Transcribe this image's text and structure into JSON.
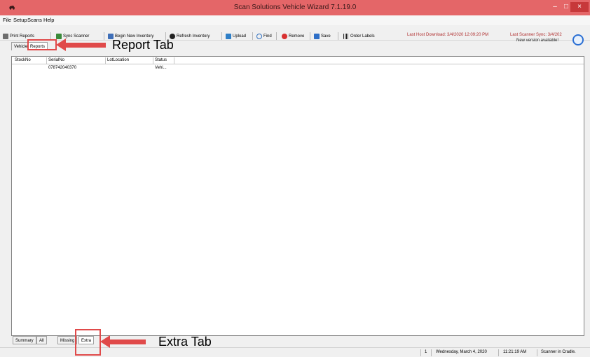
{
  "window": {
    "title": "Scan Solutions Vehicle Wizard 7.1.19.0",
    "minimize_glyph": "–",
    "maximize_glyph": "□",
    "close_glyph": "×"
  },
  "menu": [
    "File",
    "Setup",
    "Scans",
    "Help"
  ],
  "toolbar": {
    "buttons": [
      {
        "label": "Print Reports",
        "icon": "printer-icon"
      },
      {
        "label": "Sync Scanner",
        "icon": "sync-icon"
      },
      {
        "label": "Begin New Inventory",
        "icon": "new-inventory-icon"
      },
      {
        "label": "Refresh Inventory",
        "icon": "refresh-icon"
      },
      {
        "label": "Upload",
        "icon": "upload-icon"
      },
      {
        "label": "Find",
        "icon": "find-icon"
      },
      {
        "label": "Remove",
        "icon": "remove-icon"
      },
      {
        "label": "Save",
        "icon": "save-icon"
      },
      {
        "label": "Order Labels",
        "icon": "barcode-icon"
      }
    ],
    "host_status": "Last Host Download: 3/4/2020 12:09:20 PM",
    "scanner_status": "Last Scanner Sync: 3/4/202",
    "new_version": "New version available!"
  },
  "top_tabs": [
    "Vehicle",
    "Reports"
  ],
  "grid": {
    "columns": [
      "StockNo",
      "SerialNo",
      "LotLocation",
      "Status"
    ],
    "rows": [
      {
        "StockNo": "",
        "SerialNo": "078742040370",
        "LotLocation": "",
        "Status": "Vehi..."
      }
    ]
  },
  "bottom_tabs": [
    "Summary",
    "All",
    "Missing",
    "Extra"
  ],
  "status_bar": {
    "count": "1",
    "date": "Wednesday, March 4, 2020",
    "time": "11:21:19 AM",
    "scanner": "Scanner in Cradle."
  },
  "annotations": {
    "report_tab": "Report Tab",
    "extra_tab": "Extra Tab"
  },
  "colors": {
    "titlebar": "#e46668",
    "annotation": "#e04a4a",
    "status_red": "#b03030"
  }
}
